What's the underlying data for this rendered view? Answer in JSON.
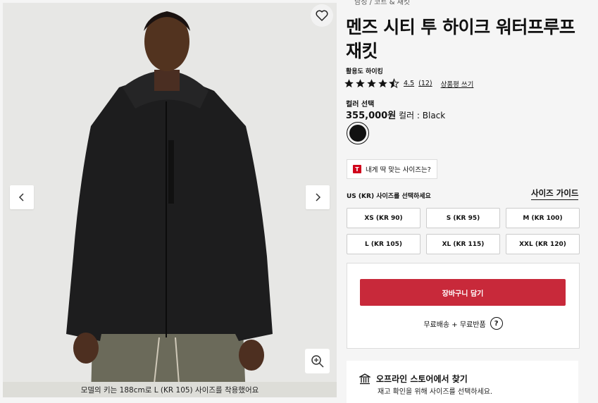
{
  "image": {
    "caption": "모델의 키는 188cm로 L (KR 105) 사이즈를 착용했어요",
    "icons": [
      "heart-icon",
      "chevron-left-icon",
      "chevron-right-icon",
      "zoom-in-icon"
    ]
  },
  "product": {
    "breadcrumb": "남성 / 코트 & 재킷",
    "title": "멘즈 시티 투 하이크 워터프루프 재킷",
    "activity": "활용도 하이킹",
    "rating": {
      "score": "4.5",
      "count": "(12)",
      "stars_value": 4.5,
      "stars_max": 5,
      "write_review": "상품평 쓰기"
    },
    "color_label": "컬러 선택",
    "price": "355,000원",
    "color_name": "컬러 : Black",
    "swatch_color": "#111111",
    "fit_button": "내게 딱 맞는 사이즈는?",
    "fit_icon_letter": "T",
    "size_label": "US (KR) 사이즈를 선택하세요",
    "size_guide": "사이즈 가이드",
    "sizes": [
      "XS (KR 90)",
      "S (KR 95)",
      "M (KR 100)",
      "L (KR 105)",
      "XL (KR 115)",
      "XXL (KR 120)"
    ]
  },
  "cart": {
    "add_button": "장바구니 담기",
    "shipping": "무료배송 + 무료반품",
    "help_glyph": "?",
    "accent": "#c8293a"
  },
  "store": {
    "title": "오프라인 스토어에서 찾기",
    "subtitle": "재고 확인을 위해 사이즈를 선택하세요."
  }
}
